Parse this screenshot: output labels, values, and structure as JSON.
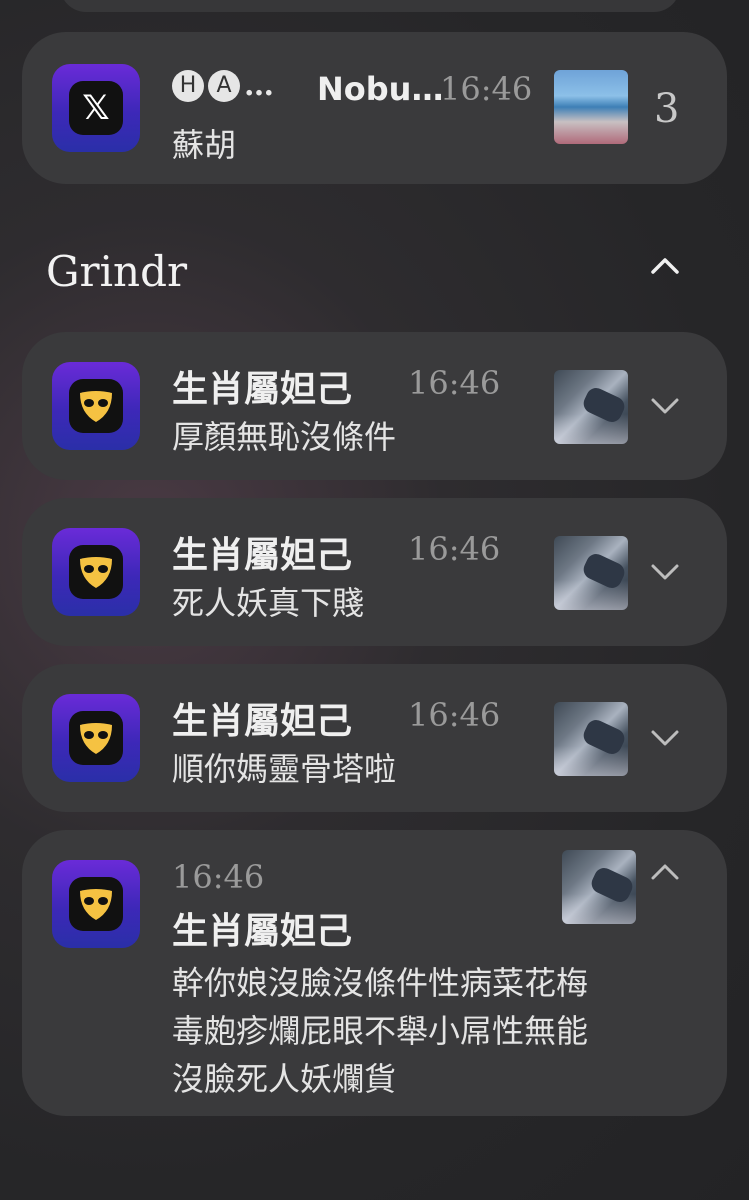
{
  "x_notification": {
    "app_icon": "x-logo-icon",
    "avatars": [
      "H",
      "A"
    ],
    "ellipsis": "…",
    "sender": "Nobu…",
    "time": "16:46",
    "message": "蘇胡",
    "count": "3"
  },
  "grindr_group": {
    "title": "Grindr",
    "collapse_icon": "chevron-up-icon"
  },
  "grindr_notifications": [
    {
      "sender": "生肖屬妲己",
      "time": "16:46",
      "message": "厚顏無恥沒條件"
    },
    {
      "sender": "生肖屬妲己",
      "time": "16:46",
      "message": "死人妖真下賤"
    },
    {
      "sender": "生肖屬妲己",
      "time": "16:46",
      "message": "順你媽靈骨塔啦"
    }
  ],
  "grindr_expanded": {
    "time": "16:46",
    "sender": "生肖屬妲己",
    "lines": [
      "幹你娘沒臉沒條件性病菜花梅",
      "毒皰疹爛屁眼不舉小屌性無能",
      "沒臉死人妖爛貨"
    ]
  }
}
